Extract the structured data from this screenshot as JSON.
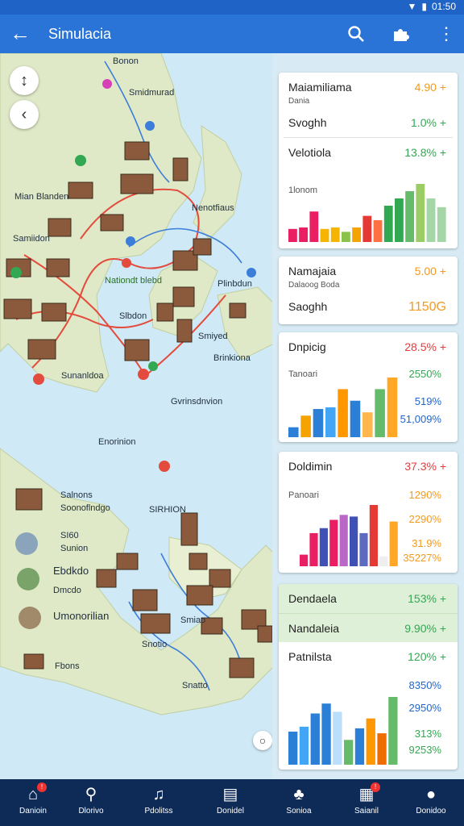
{
  "status": {
    "time": "01:50"
  },
  "appbar": {
    "title": "Simulacia"
  },
  "map": {
    "labels": [
      "Bonon",
      "Smidmurad",
      "Mian Blanden",
      "Samiidon",
      "Nenotfiaus",
      "Nationdt blebd",
      "Slbdon",
      "Smiyed",
      "Plinbdun",
      "Sunanldoa",
      "Brinkiona",
      "Gvrinsdnvion",
      "Salnons",
      "Soonoflndgo",
      "SI60",
      "Sunion",
      "Ebdkdo",
      "Dmcdo",
      "Umonorilian",
      "Enorinion",
      "SIRHION",
      "Snotio",
      "Smiao",
      "Fbons",
      "Snatto"
    ]
  },
  "panel": {
    "card1": {
      "row1": {
        "name": "Maiamiliama",
        "value": "4.90 +",
        "sub": "Dania"
      },
      "row2": {
        "name": "Svoghh",
        "value": "1.0% +"
      },
      "row3": {
        "name": "Velotiola",
        "value": "13.8% +"
      },
      "chart_label": "1lonom",
      "bars": [
        {
          "v": 18,
          "c": "#e91e63"
        },
        {
          "v": 20,
          "c": "#e91e63"
        },
        {
          "v": 42,
          "c": "#e91e63"
        },
        {
          "v": 18,
          "c": "#f4b400"
        },
        {
          "v": 20,
          "c": "#f4b400"
        },
        {
          "v": 14,
          "c": "#8bc34a"
        },
        {
          "v": 20,
          "c": "#f4a300"
        },
        {
          "v": 36,
          "c": "#e53935"
        },
        {
          "v": 30,
          "c": "#ff7043"
        },
        {
          "v": 50,
          "c": "#33a852"
        },
        {
          "v": 60,
          "c": "#33a852"
        },
        {
          "v": 70,
          "c": "#66bb6a"
        },
        {
          "v": 80,
          "c": "#9ccc65"
        },
        {
          "v": 60,
          "c": "#a5d6a7"
        },
        {
          "v": 48,
          "c": "#a5d6a7"
        }
      ]
    },
    "card2": {
      "row1": {
        "name": "Namajaia",
        "value": "5.00 +",
        "sub": "Dalaoog Boda"
      },
      "row2": {
        "name": "Saoghh",
        "value": "1150G"
      }
    },
    "card3": {
      "title": "Dnpicig",
      "title_value": "28.5% +",
      "chart_label": "Tanoari",
      "values": [
        "2550%",
        "519%",
        "51,009%"
      ],
      "bars": [
        {
          "v": 12,
          "c": "#2b7fd6"
        },
        {
          "v": 26,
          "c": "#f4a300"
        },
        {
          "v": 34,
          "c": "#2b7fd6"
        },
        {
          "v": 36,
          "c": "#42a5f5"
        },
        {
          "v": 58,
          "c": "#ff9800"
        },
        {
          "v": 44,
          "c": "#2b7fd6"
        },
        {
          "v": 30,
          "c": "#ffb74d"
        },
        {
          "v": 58,
          "c": "#66bb6a"
        },
        {
          "v": 72,
          "c": "#ffa726"
        }
      ]
    },
    "card4": {
      "title": "Doldimin",
      "title_value": "37.3% +",
      "chart_label": "Panoari",
      "values": [
        "1290%",
        "2290%",
        "31.9%",
        "35227%"
      ],
      "bars": [
        {
          "v": 14,
          "c": "#e91e63"
        },
        {
          "v": 40,
          "c": "#e91e63"
        },
        {
          "v": 46,
          "c": "#3f51b5"
        },
        {
          "v": 56,
          "c": "#e91e63"
        },
        {
          "v": 62,
          "c": "#ba68c8"
        },
        {
          "v": 60,
          "c": "#3f51b5"
        },
        {
          "v": 40,
          "c": "#5c6bc0"
        },
        {
          "v": 74,
          "c": "#e53935"
        },
        {
          "v": 12,
          "c": "#eeeeee"
        },
        {
          "v": 54,
          "c": "#ffa726"
        }
      ]
    },
    "card5": {
      "row1": {
        "name": "Dendaela",
        "value": "153% +"
      },
      "row2": {
        "name": "Nandaleia",
        "value": "9.90% +"
      },
      "row3": {
        "name": "Patnilsta",
        "value": "120% +"
      },
      "values": [
        "8350%",
        "2950%",
        "313%",
        "9253%"
      ],
      "bars": [
        {
          "v": 40,
          "c": "#2b7fd6"
        },
        {
          "v": 46,
          "c": "#42a5f5"
        },
        {
          "v": 62,
          "c": "#2b7fd6"
        },
        {
          "v": 74,
          "c": "#2b7fd6"
        },
        {
          "v": 64,
          "c": "#bbdefb"
        },
        {
          "v": 30,
          "c": "#66bb6a"
        },
        {
          "v": 44,
          "c": "#2b7fd6"
        },
        {
          "v": 56,
          "c": "#ff9800"
        },
        {
          "v": 38,
          "c": "#ef6c00"
        },
        {
          "v": 82,
          "c": "#66bb6a"
        }
      ]
    }
  },
  "nav": {
    "items": [
      {
        "label": "Danioin",
        "icon": "home-icon"
      },
      {
        "label": "Dlorivo",
        "icon": "search-icon"
      },
      {
        "label": "Pdolitss",
        "icon": "music-icon"
      },
      {
        "label": "Donidel",
        "icon": "inbox-icon"
      },
      {
        "label": "Sonioa",
        "icon": "puzzle-icon"
      },
      {
        "label": "Saianil",
        "icon": "calendar-icon"
      },
      {
        "label": "Donidoo",
        "icon": "profile-icon"
      }
    ]
  },
  "colors": {
    "appbar": "#2a74d8",
    "nav": "#0e2b57",
    "map_water": "#cfe9f6",
    "map_land": "#dfe9c7"
  }
}
